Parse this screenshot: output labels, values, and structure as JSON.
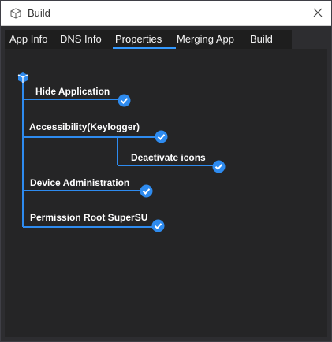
{
  "window": {
    "title": "Build",
    "icon": "package-icon",
    "close_icon": "close-icon"
  },
  "tabs": [
    {
      "label": "App Info",
      "active": false
    },
    {
      "label": "DNS Info",
      "active": false
    },
    {
      "label": "Properties",
      "active": true
    },
    {
      "label": "Merging App",
      "active": false
    },
    {
      "label": "Build",
      "active": false
    }
  ],
  "tree": {
    "root_icon": "cube-icon",
    "nodes": [
      {
        "label": "Hide Application",
        "checked": true
      },
      {
        "label": "Accessibility(Keylogger)",
        "checked": true,
        "children": [
          {
            "label": "Deactivate icons",
            "checked": true
          }
        ]
      },
      {
        "label": "Device Administration",
        "checked": true
      },
      {
        "label": "Permission Root SuperSU",
        "checked": true
      }
    ]
  },
  "colors": {
    "accent": "#3399ff",
    "tree_line": "#2e8bef",
    "background": "#252526",
    "tab_background": "#1e1e1e"
  }
}
